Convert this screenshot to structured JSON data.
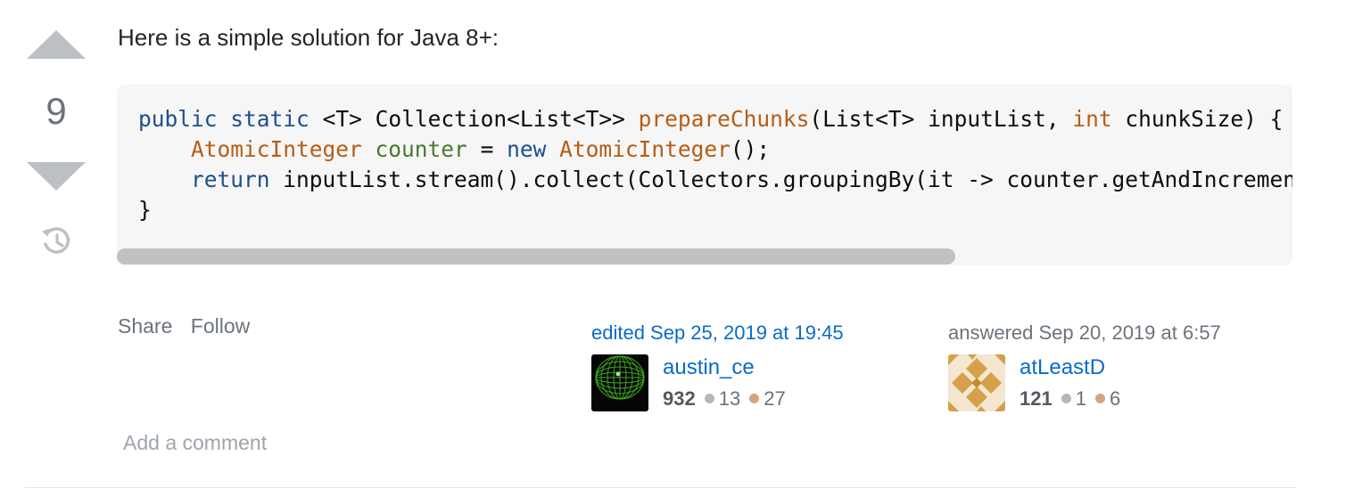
{
  "vote": {
    "count": "9"
  },
  "post": {
    "intro": "Here is a simple solution for Java 8+:",
    "code_lines": {
      "l1": {
        "a": "public",
        "b": "static",
        "c": "<T> Collection<List<T>> ",
        "d": "prepareChunks",
        "e": "(List<T> inputList, ",
        "f": "int",
        "g": " chunkSize) {"
      },
      "l2": {
        "a": "AtomicInteger",
        "b": "counter",
        "c": " = ",
        "d": "new",
        "e": "AtomicInteger",
        "f": "();"
      },
      "l3": {
        "a": "return",
        "b": " inputList.stream().collect(Collectors.groupingBy(it -> counter.getAndIncrement() / chunkSize)).values();"
      },
      "l4": {
        "a": "}"
      }
    }
  },
  "menu": {
    "share": "Share",
    "follow": "Follow"
  },
  "edited": {
    "action": "edited Sep 25, 2019 at 19:45",
    "user": "austin_ce",
    "rep": "932",
    "silver": "13",
    "bronze": "27"
  },
  "answered": {
    "action": "answered Sep 20, 2019 at 6:57",
    "user": "atLeastD",
    "rep": "121",
    "silver": "1",
    "bronze": "6"
  },
  "comments": {
    "add": "Add a comment"
  },
  "icons": {
    "vote_up": "arrow-up-icon",
    "vote_down": "arrow-down-icon",
    "history": "history-icon"
  },
  "colors": {
    "link": "#0a6bc9",
    "muted": "#6a737c",
    "code_bg": "#f6f6f6"
  }
}
